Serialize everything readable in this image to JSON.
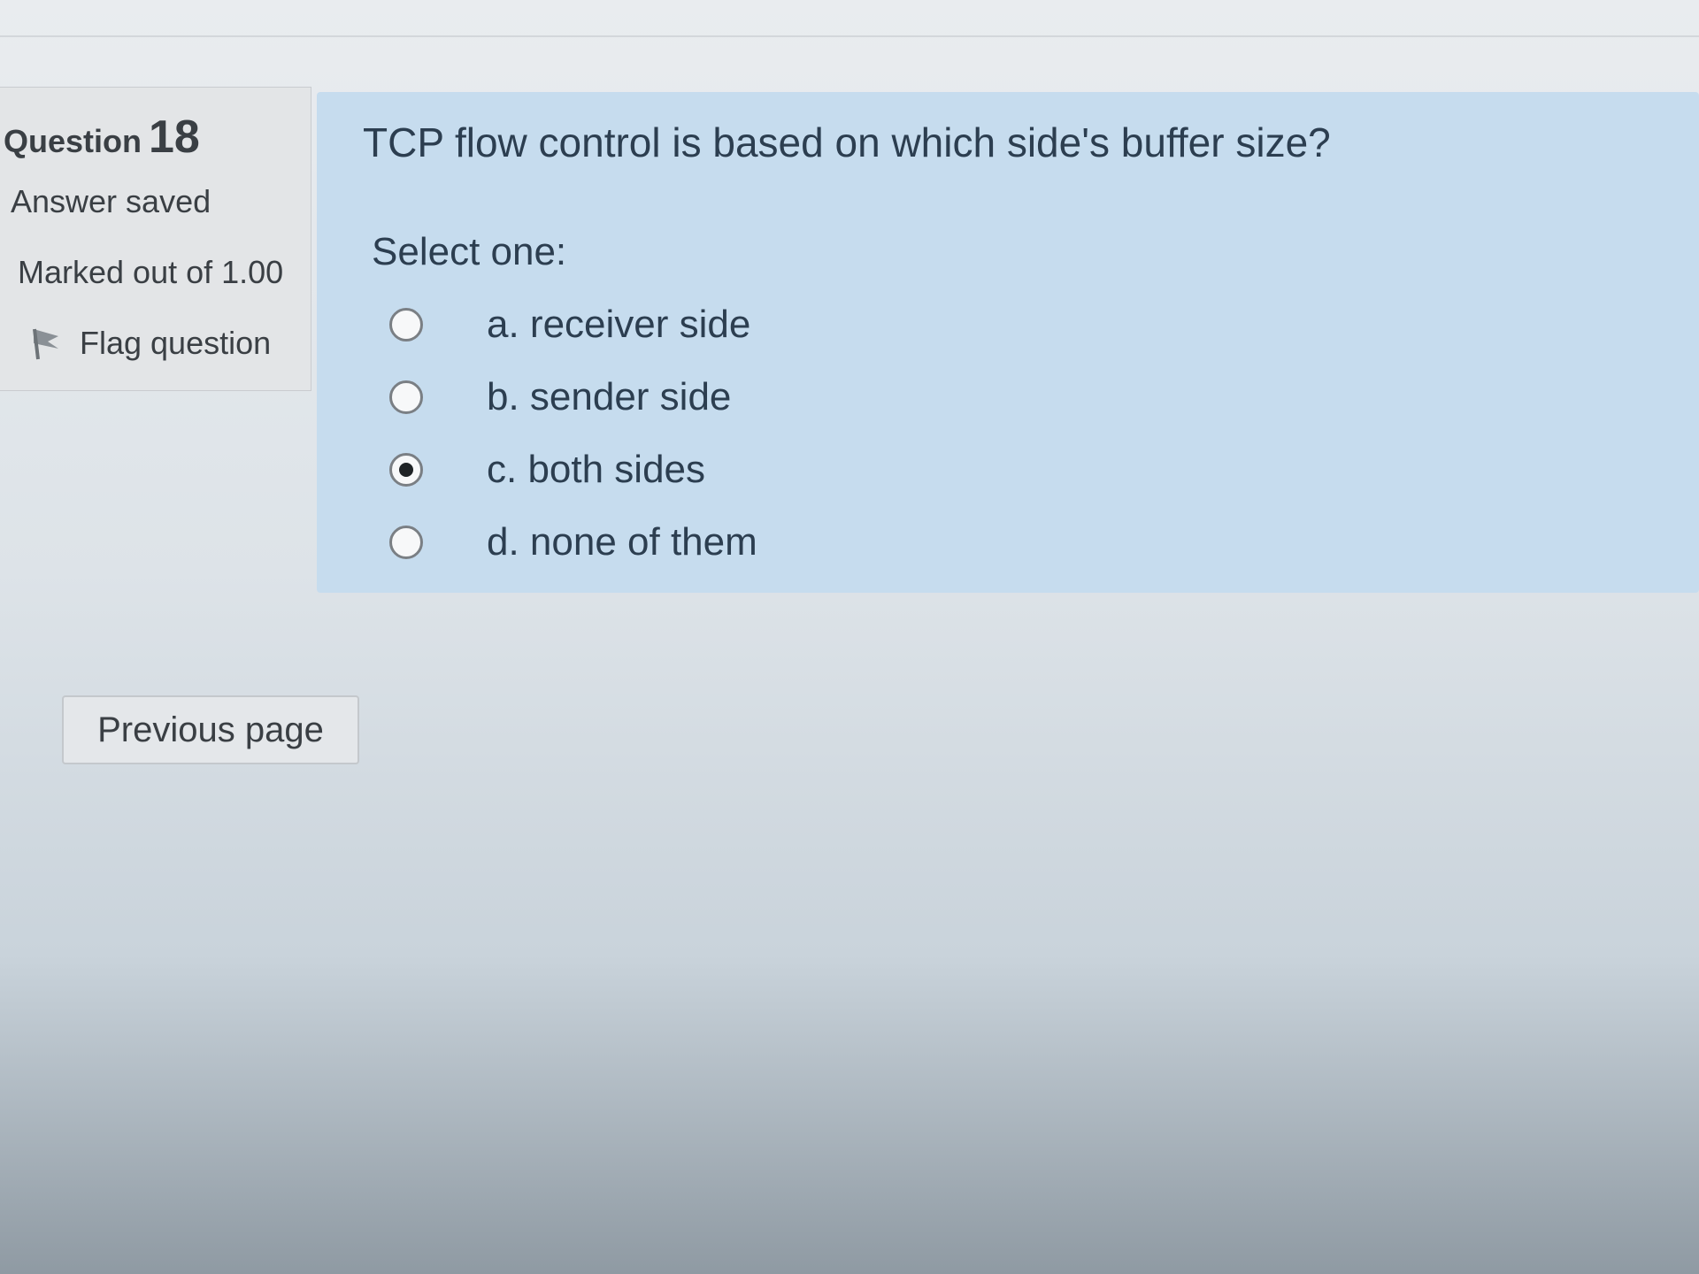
{
  "question_info": {
    "heading_label": "Question",
    "number": "18",
    "state": "Answer saved",
    "grade": "Marked out of 1.00",
    "flag_label": "Flag question",
    "flag_icon": "flag-icon"
  },
  "question": {
    "text": "TCP flow control is based on which side's buffer size?",
    "prompt": "Select one:",
    "options": [
      {
        "label": "a. receiver side",
        "selected": false
      },
      {
        "label": "b. sender side",
        "selected": false
      },
      {
        "label": "c. both sides",
        "selected": true
      },
      {
        "label": "d. none of them",
        "selected": false
      }
    ]
  },
  "navigation": {
    "previous_label": "Previous page"
  },
  "colors": {
    "content_background": "#c6dcee",
    "info_background": "#e3e5e7",
    "text": "#2c3e50"
  }
}
